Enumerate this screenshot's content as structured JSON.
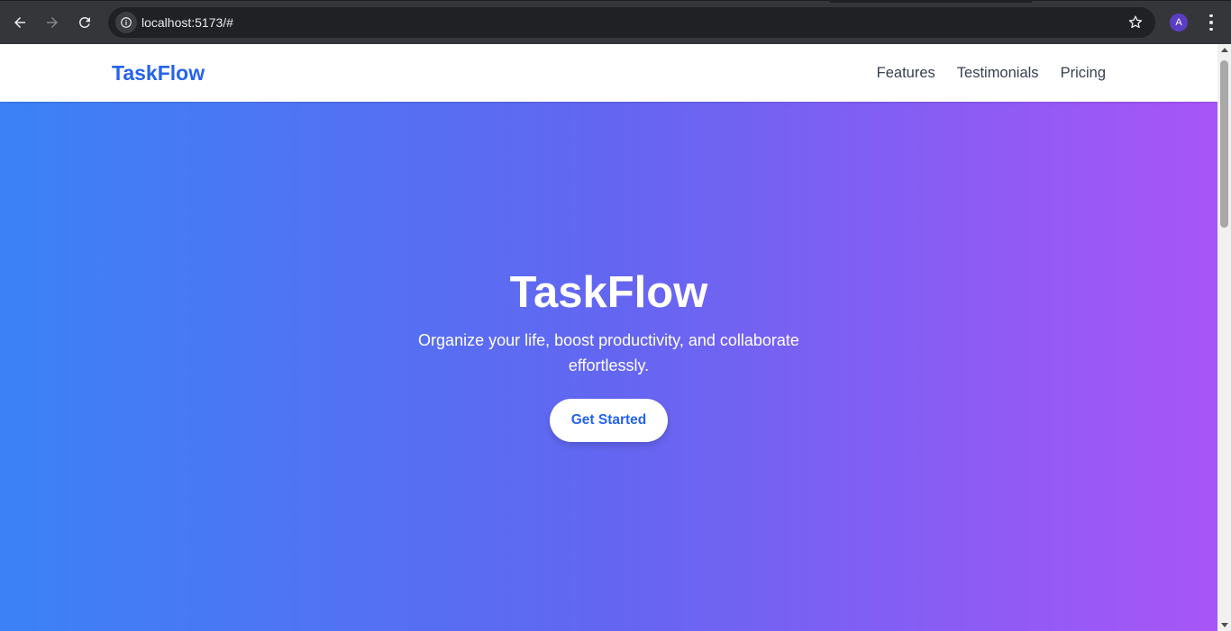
{
  "browser": {
    "url": "localhost:5173/#",
    "profile_initial": "A"
  },
  "site": {
    "brand": "TaskFlow",
    "nav": [
      "Features",
      "Testimonials",
      "Pricing"
    ]
  },
  "hero": {
    "title": "TaskFlow",
    "subtitle": "Organize your life, boost productivity, and collaborate effortlessly.",
    "cta_label": "Get Started"
  },
  "colors": {
    "brand": "#2563eb",
    "gradient_start": "#3b82f6",
    "gradient_mid": "#6366f1",
    "gradient_end": "#a855f7"
  },
  "icons": [
    "back-arrow-icon",
    "forward-arrow-icon",
    "reload-icon",
    "info-icon",
    "star-icon",
    "menu-dots-icon"
  ]
}
